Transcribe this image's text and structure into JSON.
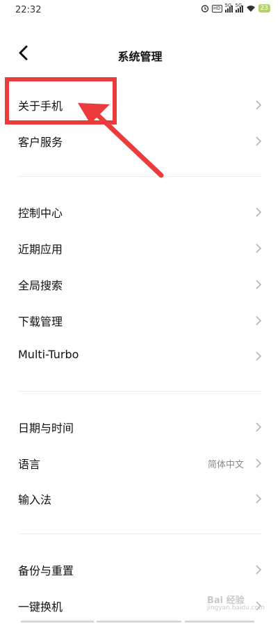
{
  "status": {
    "time": "22:32",
    "hd": "HD",
    "sig1": "5G",
    "sig2": "5G",
    "battery": "23"
  },
  "header": {
    "title": "系统管理"
  },
  "groups": [
    {
      "items": [
        {
          "label": "关于手机"
        },
        {
          "label": "客户服务"
        }
      ]
    },
    {
      "items": [
        {
          "label": "控制中心"
        },
        {
          "label": "近期应用"
        },
        {
          "label": "全局搜索"
        },
        {
          "label": "下载管理"
        },
        {
          "label": "Multi-Turbo"
        }
      ]
    },
    {
      "items": [
        {
          "label": "日期与时间"
        },
        {
          "label": "语言",
          "value": "简体中文"
        },
        {
          "label": "输入法"
        }
      ]
    },
    {
      "items": [
        {
          "label": "备份与重置"
        },
        {
          "label": "一键换机"
        }
      ]
    }
  ],
  "watermark": {
    "brand": "Bai 经验",
    "url": "jingyan.baidu.com"
  },
  "annotation": {
    "color": "#ec3b3b"
  }
}
